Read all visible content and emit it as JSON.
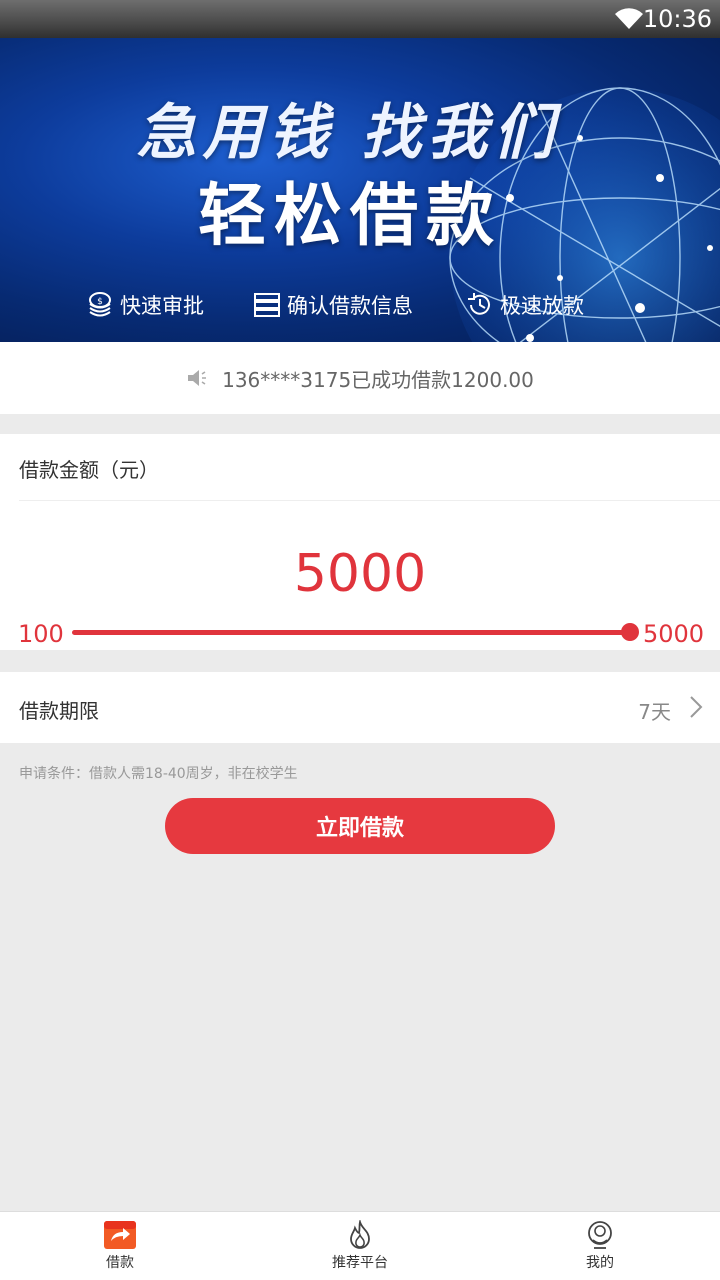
{
  "status_bar": {
    "time": "10:36",
    "wifi_icon": "wifi-icon"
  },
  "banner": {
    "headline": "急用钱  找我们",
    "subheadline": "轻松借款",
    "features": [
      {
        "icon": "coins-icon",
        "label": "快速审批"
      },
      {
        "icon": "server-list-icon",
        "label": "确认借款信息"
      },
      {
        "icon": "clock-refresh-icon",
        "label": "极速放款"
      }
    ]
  },
  "notice": {
    "icon": "speaker-icon",
    "text": "136****3175已成功借款1200.00"
  },
  "loan_amount": {
    "label": "借款金额（元）",
    "value": "5000",
    "min_label": "100",
    "max_label": "5000",
    "slider_min": 100,
    "slider_max": 5000,
    "slider_value": 5000,
    "accent_color": "#e0343c"
  },
  "loan_term": {
    "label": "借款期限",
    "value": "7天"
  },
  "conditions": "申请条件：借款人需18-40周岁，非在校学生",
  "apply_button": "立即借款",
  "tab_bar": {
    "items": [
      {
        "icon": "loan-icon",
        "label": "借款",
        "active": true
      },
      {
        "icon": "fire-icon",
        "label": "推荐平台",
        "active": false
      },
      {
        "icon": "profile-icon",
        "label": "我的",
        "active": false
      }
    ]
  }
}
